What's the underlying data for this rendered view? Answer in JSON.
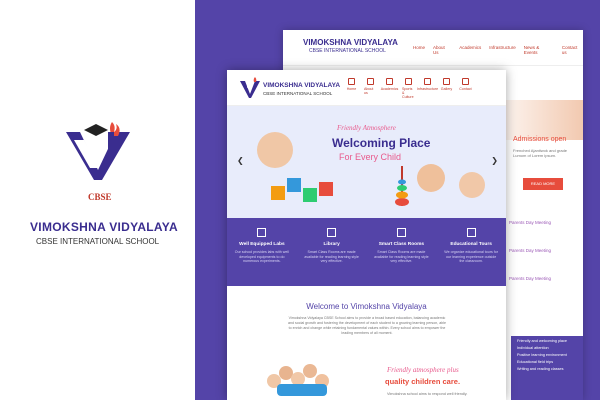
{
  "brand": {
    "name": "VIMOKSHNA  VIDYALAYA",
    "subtitle": "CBSE INTERNATIONAL SCHOOL",
    "badge": "CBSE"
  },
  "back_page": {
    "title": "VIMOKSHNA VIDYALAYA",
    "subtitle": "CBSE INTERNATIONAL SCHOOL",
    "nav": [
      "Home",
      "About Us",
      "Academics",
      "Infrastructure",
      "News & Events",
      "Contact us"
    ],
    "admission": "Admissions open",
    "admission_text": "Frenched Ajantiwok and grade Lumom of Lorem ipsum.",
    "read_more": "READ MORE",
    "news": [
      "Parents Day Meeting",
      "Parents Day Meeting",
      "Parents Day Meeting"
    ],
    "side_list": [
      "Friendly and welcoming place",
      "Individual attention",
      "Positive learning environment",
      "Educational field trips",
      "Writing and reading classes"
    ]
  },
  "front_page": {
    "title": "VIMOKSHNA VIDYALAYA",
    "subtitle": "CBSE INTERNATIONAL SCHOOL",
    "nav": [
      "Home",
      "About us",
      "Academics",
      "Sports & Culture",
      "Infrastructure",
      "Gallery",
      "Contact"
    ],
    "hero": {
      "kicker": "Friendly Atmosphere",
      "headline": "Welcoming Place",
      "tagline": "For Every Child",
      "prev": "❮",
      "next": "❯"
    },
    "features": [
      {
        "title": "Well Equipped Labs",
        "desc": "Our school provides labs with well developed equipments to do numerous experiments."
      },
      {
        "title": "Library",
        "desc": "Smart Class Rooms are made available for reading learning style very effective."
      },
      {
        "title": "Smart Class Rooms",
        "desc": "Smart Class Rooms are made available for reading learning style very effective."
      },
      {
        "title": "Educational Tours",
        "desc": "We organize educational tours for our learning experience outside the classroom."
      }
    ],
    "welcome_heading": "Welcome to Vimokshna Vidyalaya",
    "welcome_text": "Vimokshna Vidyalaya CBSE School aims to provide a broad based education, balancing academic and social growth and fostering the development of each student to a growing learning person, able to enrich and change while retaining fundamental values within. Every school aims to empower the leading members of all moment.",
    "friendly_line1": "Friendly atmosphere plus",
    "friendly_line2": "quality children care.",
    "friendly_text": "Vimokshna school aims to respond well friendly."
  },
  "colors": {
    "accent": "#5444a8",
    "brand_text": "#3a2d8f",
    "pink": "#e85a8c",
    "red": "#e74c3c"
  }
}
